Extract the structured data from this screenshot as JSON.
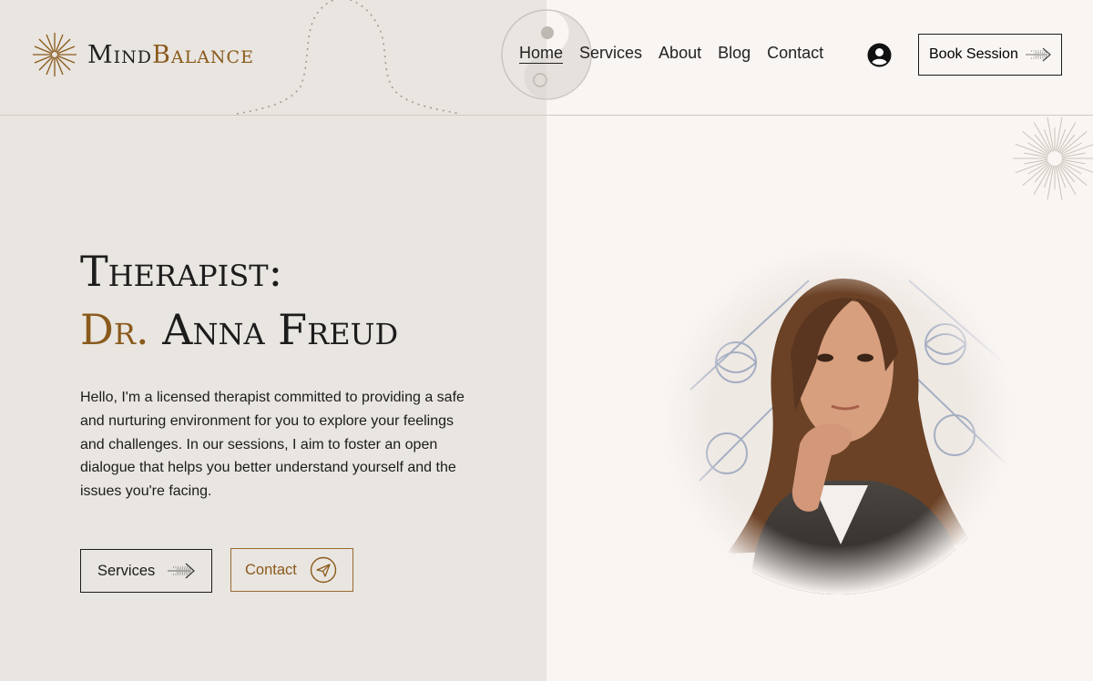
{
  "brand": {
    "name_part1": "Mind",
    "name_part2": "Balance",
    "icon": "sunburst-icon"
  },
  "nav": {
    "items": [
      {
        "label": "Home",
        "active": true
      },
      {
        "label": "Services",
        "active": false
      },
      {
        "label": "About",
        "active": false
      },
      {
        "label": "Blog",
        "active": false
      },
      {
        "label": "Contact",
        "active": false
      }
    ],
    "account_icon": "user-avatar-icon",
    "book_label": "Book Session",
    "book_icon": "arrow-right-icon"
  },
  "hero": {
    "title_line1": "Therapist:",
    "title_prefix": "Dr.",
    "title_name": "Anna Freud",
    "intro": "Hello, I'm a licensed therapist committed to providing a safe and nurturing environment for you to explore your feelings and challenges. In our sessions, I aim to foster an open dialogue that helps you better understand yourself and the issues you're facing.",
    "buttons": {
      "services_label": "Services",
      "services_icon": "arrow-right-icon",
      "contact_label": "Contact",
      "contact_icon": "send-icon"
    },
    "photo_icon": "therapist-portrait"
  },
  "colors": {
    "accent": "#8a5a1c",
    "left_bg": "#e9e5e0",
    "right_bg": "#f9f5f2",
    "text": "#1c1c1c"
  }
}
